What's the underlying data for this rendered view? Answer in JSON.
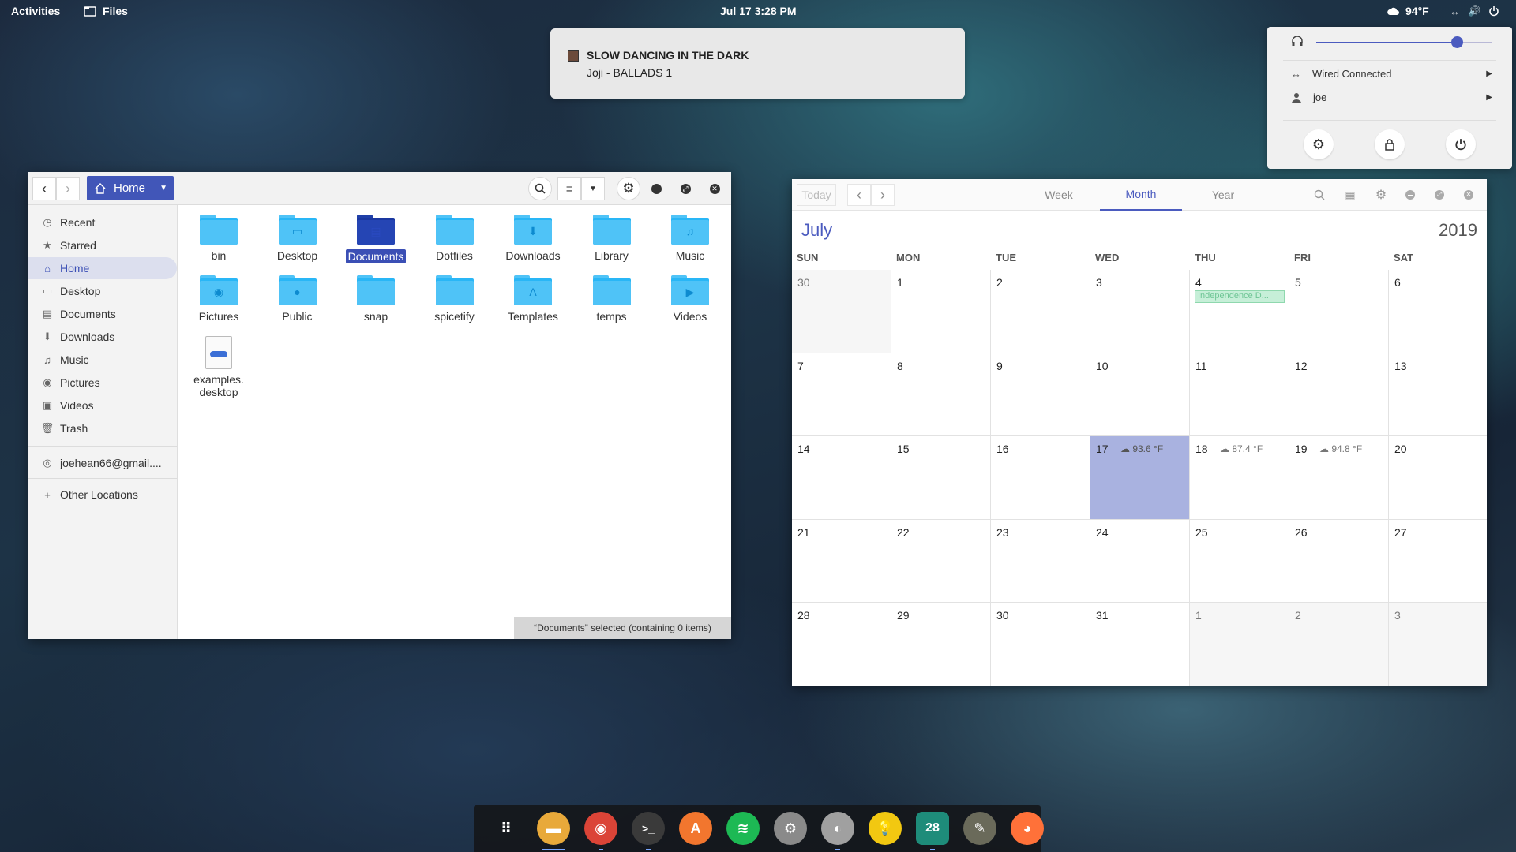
{
  "topbar": {
    "activities": "Activities",
    "app_name": "Files",
    "clock": "Jul 17   3:28 PM",
    "weather": "94°F"
  },
  "notification": {
    "title": "SLOW DANCING IN THE DARK",
    "subtitle": "Joji - BALLADS 1"
  },
  "system_menu": {
    "volume_level": 0.8,
    "network_label": "Wired Connected",
    "user_label": "joe",
    "icons": [
      "settings-icon",
      "lock-icon",
      "power-icon"
    ]
  },
  "files": {
    "path_label": "Home",
    "sidebar": [
      {
        "label": "Recent",
        "icon": "recent-icon"
      },
      {
        "label": "Starred",
        "icon": "star-icon"
      },
      {
        "label": "Home",
        "icon": "home-icon",
        "active": true
      },
      {
        "label": "Desktop",
        "icon": "desktop-icon"
      },
      {
        "label": "Documents",
        "icon": "documents-icon"
      },
      {
        "label": "Downloads",
        "icon": "downloads-icon"
      },
      {
        "label": "Music",
        "icon": "music-icon"
      },
      {
        "label": "Pictures",
        "icon": "pictures-icon"
      },
      {
        "label": "Videos",
        "icon": "videos-icon"
      },
      {
        "label": "Trash",
        "icon": "trash-icon"
      }
    ],
    "account": "joehean66@gmail....",
    "other_locations": "Other Locations",
    "items": [
      {
        "label": "bin",
        "glyph": ""
      },
      {
        "label": "Desktop",
        "glyph": "▭"
      },
      {
        "label": "Documents",
        "glyph": "▤",
        "selected": true
      },
      {
        "label": "Dotfiles",
        "glyph": ""
      },
      {
        "label": "Downloads",
        "glyph": "⬇"
      },
      {
        "label": "Library",
        "glyph": ""
      },
      {
        "label": "Music",
        "glyph": "♫"
      },
      {
        "label": "Pictures",
        "glyph": "◉"
      },
      {
        "label": "Public",
        "glyph": "●"
      },
      {
        "label": "snap",
        "glyph": ""
      },
      {
        "label": "spicetify",
        "glyph": ""
      },
      {
        "label": "Templates",
        "glyph": "A"
      },
      {
        "label": "temps",
        "glyph": ""
      },
      {
        "label": "Videos",
        "glyph": "▶"
      }
    ],
    "file_item": {
      "line1": "examples.",
      "line2": "desktop"
    },
    "status": "“Documents” selected  (containing 0 items)"
  },
  "calendar": {
    "today_btn": "Today",
    "tabs": [
      "Week",
      "Month",
      "Year"
    ],
    "active_tab": "Month",
    "month": "July",
    "year": "2019",
    "dow": [
      "SUN",
      "MON",
      "TUE",
      "WED",
      "THU",
      "FRI",
      "SAT"
    ],
    "weeks": [
      [
        "30",
        "1",
        "2",
        "3",
        "4",
        "5",
        "6"
      ],
      [
        "7",
        "8",
        "9",
        "10",
        "11",
        "12",
        "13"
      ],
      [
        "14",
        "15",
        "16",
        "17",
        "18",
        "19",
        "20"
      ],
      [
        "21",
        "22",
        "23",
        "24",
        "25",
        "26",
        "27"
      ],
      [
        "28",
        "29",
        "30",
        "31",
        "1",
        "2",
        "3"
      ]
    ],
    "event": {
      "label": "Independence D...",
      "week": 0,
      "day": 4
    },
    "weather": [
      {
        "week": 2,
        "day": 3,
        "text": "93.6 °F"
      },
      {
        "week": 2,
        "day": 4,
        "text": "87.4 °F"
      },
      {
        "week": 2,
        "day": 5,
        "text": "94.8 °F"
      }
    ],
    "today": {
      "week": 2,
      "day": 3
    }
  },
  "dock": {
    "apps": [
      {
        "name": "app-grid",
        "color": "#000000",
        "glyph": "⠿"
      },
      {
        "name": "files",
        "color": "#e8a93a",
        "glyph": "▬"
      },
      {
        "name": "chrome",
        "color": "#db4437",
        "glyph": "◉"
      },
      {
        "name": "terminal",
        "color": "#3a3a3a",
        "glyph": ">_"
      },
      {
        "name": "software",
        "color": "#f2762e",
        "glyph": "A"
      },
      {
        "name": "spotify",
        "color": "#1db954",
        "glyph": "≋"
      },
      {
        "name": "settings",
        "color": "#8a8a8a",
        "glyph": "⚙"
      },
      {
        "name": "tweaks",
        "color": "#a0a0a0",
        "glyph": "◐"
      },
      {
        "name": "ideas",
        "color": "#f2c811",
        "glyph": "💡"
      },
      {
        "name": "calendar",
        "color": "#1e8c7a",
        "glyph": "28"
      },
      {
        "name": "gimp",
        "color": "#6a6a5a",
        "glyph": "✎"
      },
      {
        "name": "firefox",
        "color": "#ff7139",
        "glyph": "◕"
      }
    ]
  },
  "colors": {
    "accent": "#4b5bbf",
    "folder": "#4fc3f7",
    "selected_folder": "#2545b4"
  }
}
